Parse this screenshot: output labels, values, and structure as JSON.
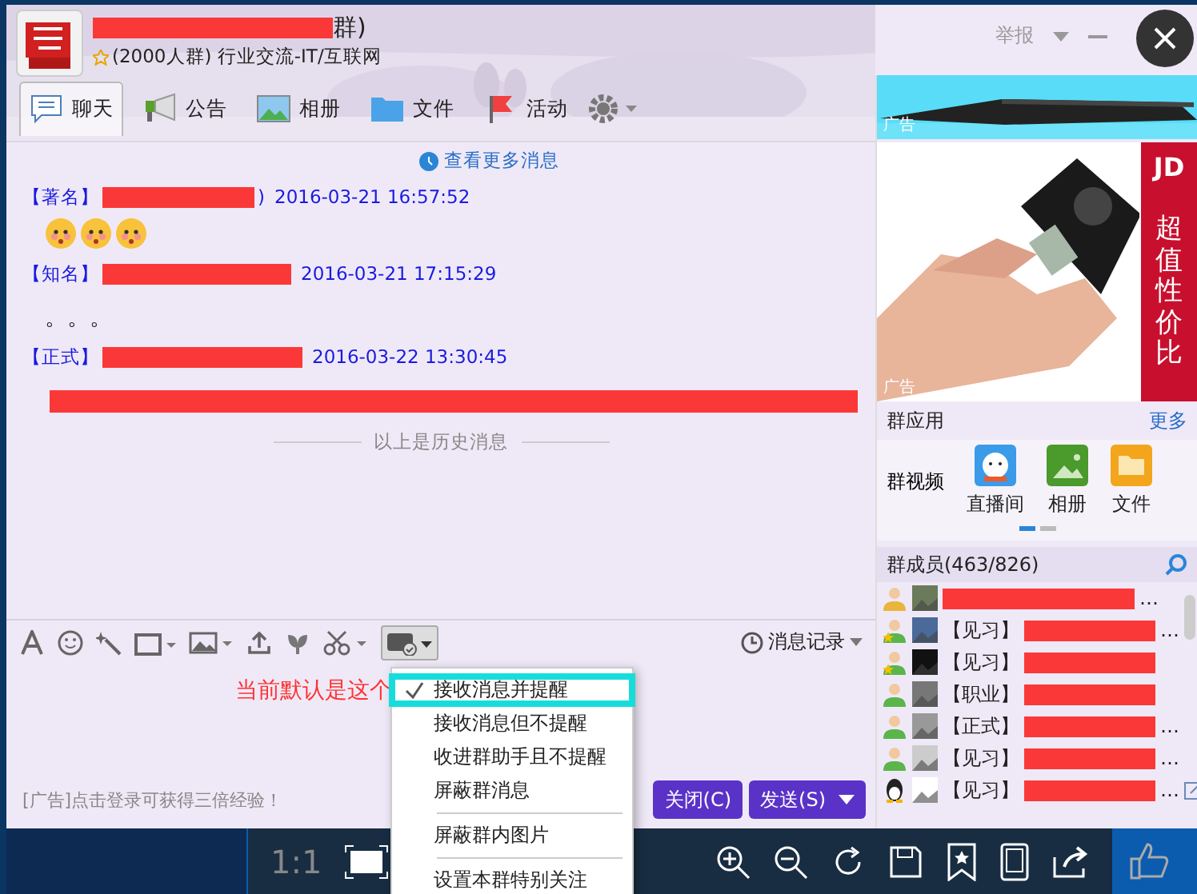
{
  "window": {
    "title": "群)",
    "subtitle": "(2000人群) 行业交流-IT/互联网",
    "report": "举报"
  },
  "tabs": [
    {
      "label": "聊天",
      "selected": true,
      "kind": "chat"
    },
    {
      "label": "公告",
      "selected": false,
      "kind": "notice"
    },
    {
      "label": "相册",
      "selected": false,
      "kind": "album"
    },
    {
      "label": "文件",
      "selected": false,
      "kind": "file"
    },
    {
      "label": "活动",
      "selected": false,
      "kind": "event"
    }
  ],
  "chat": {
    "more_link": "查看更多消息",
    "messages": [
      {
        "tag": "【著名】",
        "suffix": ")",
        "time": "2016-03-21 16:57:52",
        "kind": "emoji"
      },
      {
        "tag": "【知名】",
        "time": "2016-03-21 17:15:29",
        "kind": "text",
        "body": "。。。"
      },
      {
        "tag": "【正式】",
        "time": "2016-03-22 13:30:45",
        "kind": "redacted"
      }
    ],
    "history_divider": "以上是历史消息"
  },
  "ads": {
    "banner_label": "广告",
    "picture_label": "广告",
    "brand": "JD",
    "slogan": "超值性价比"
  },
  "group_apps": {
    "title": "群应用",
    "more": "更多",
    "video": "群视频",
    "apps": [
      {
        "label": "直播间",
        "kind": "live"
      },
      {
        "label": "相册",
        "kind": "album"
      },
      {
        "label": "文件",
        "kind": "file"
      }
    ],
    "pages": [
      {
        "selected": true
      },
      {
        "selected": false
      }
    ]
  },
  "members": {
    "title": "群成员(463/826)",
    "rows": [
      {
        "kind": "owner",
        "suffix": "…"
      },
      {
        "kind": "admin",
        "tag": "【见习】",
        "suffix": "…"
      },
      {
        "kind": "admin",
        "tag": "【见习】"
      },
      {
        "kind": "member",
        "tag": "【职业】"
      },
      {
        "kind": "member",
        "tag": "【正式】",
        "suffix": "…"
      },
      {
        "kind": "member",
        "tag": "【见习】",
        "suffix": "…"
      },
      {
        "kind": "qq",
        "tag": "【见习】",
        "suffix": "…"
      }
    ]
  },
  "toolbar": {
    "history": "消息记录"
  },
  "annotation": "当前默认是这个",
  "menu": [
    [
      {
        "label": "接收消息并提醒",
        "checked": true,
        "highlighted": true
      },
      {
        "label": "接收消息但不提醒",
        "checked": false,
        "highlighted": false
      },
      {
        "label": "收进群助手且不提醒",
        "checked": false,
        "highlighted": false
      },
      {
        "label": "屏蔽群消息",
        "checked": false,
        "highlighted": false
      }
    ],
    [
      {
        "label": "屏蔽群内图片",
        "checked": false,
        "highlighted": false
      }
    ],
    [
      {
        "label": "设置本群特别关注",
        "checked": false,
        "highlighted": false
      }
    ]
  ],
  "ad_text": "[广告]点击登录可获得三倍经验！",
  "buttons": {
    "close": "关闭(C)",
    "send": "发送(S)"
  },
  "viewer": {
    "ratio": "1:1"
  }
}
